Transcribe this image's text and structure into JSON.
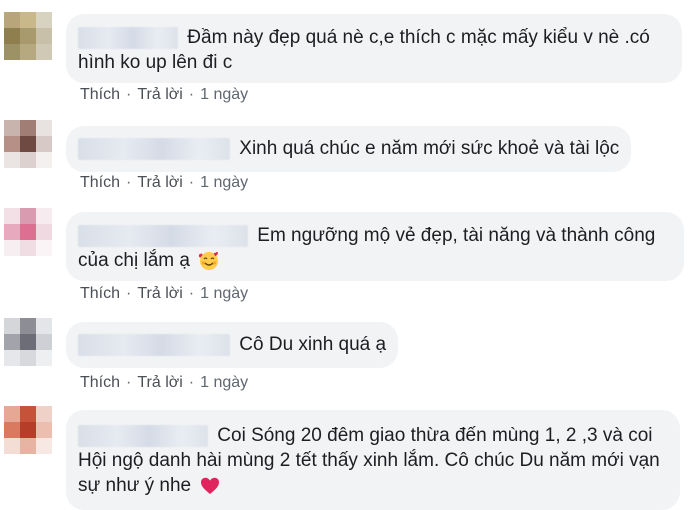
{
  "comments": [
    {
      "text": "Đầm này đẹp quá nè c,e thích c mặc mấy kiểu v nè .có hình ko up lên đi c",
      "like": "Thích",
      "reply": "Trả lời",
      "time": "1 ngày",
      "avatar_colors": [
        "#b8a57a",
        "#c9b889",
        "#d8d2c0",
        "#8f7f4f",
        "#a89a6d",
        "#c8c0a8",
        "#9d9166",
        "#b6a97f",
        "#d0c9b5"
      ]
    },
    {
      "text": "Xinh quá chúc e năm mới sức khoẻ và tài lộc",
      "like": "Thích",
      "reply": "Trả lời",
      "time": "1 ngày",
      "avatar_colors": [
        "#c9b3ad",
        "#a07e75",
        "#e8e2e0",
        "#b69087",
        "#6f4a43",
        "#d7c9c5",
        "#eae4e2",
        "#dcd1ce",
        "#f4f0ef"
      ]
    },
    {
      "text": "Em ngưỡng mộ vẻ đẹp, tài năng và thành công của chị lắm ạ",
      "emoji": "smiling-face-with-hearts",
      "like": "Thích",
      "reply": "Trả lời",
      "time": "1 ngày",
      "avatar_colors": [
        "#f3dfe6",
        "#d99bb0",
        "#f6ecef",
        "#e7a9bd",
        "#dc6f92",
        "#f0d9e1",
        "#f7eef1",
        "#efdde3",
        "#faf4f6"
      ]
    },
    {
      "text": "Cô Du xinh quá ạ",
      "like": "Thích",
      "reply": "Trả lời",
      "time": "1 ngày",
      "avatar_colors": [
        "#d5d6da",
        "#8c8d95",
        "#e4e5e8",
        "#a3a4ab",
        "#6c6d76",
        "#cfd0d5",
        "#e6e7ea",
        "#d8d9dd",
        "#eeeff1"
      ]
    },
    {
      "text": "Coi Sóng 20 đêm giao thừa đến mùng 1, 2 ,3 và coi Hội ngộ danh hài mùng 2 tết thấy xinh lắm. Cô chúc Du năm mới vạn sự như ý nhe",
      "emoji": "red-heart",
      "avatar_colors": [
        "#e6a894",
        "#c7523a",
        "#f0d1c7",
        "#d9795f",
        "#b63e29",
        "#ebbeaf",
        "#f3ddd5",
        "#e7b3a2",
        "#f7e8e3"
      ]
    }
  ],
  "colors": {
    "bubble": "#f2f3f5",
    "action_text": "#606770",
    "body_text": "#1c1e21",
    "heart": "#e0245e"
  }
}
